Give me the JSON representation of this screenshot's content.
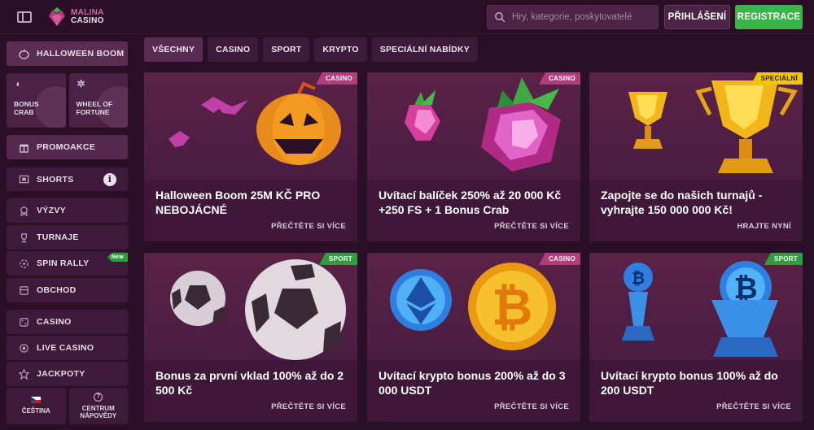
{
  "header": {
    "brand_line1": "MALINA",
    "brand_line2": "CASINO",
    "search_placeholder": "Hry, kategorie, poskytovatelé",
    "login_label": "PŘIHLÁŠENÍ",
    "register_label": "REGISTRACE"
  },
  "sidebar": {
    "halloween": "HALLOWEEN BOOM",
    "tiles": [
      {
        "label1": "BONUS",
        "label2": "CRAB"
      },
      {
        "label1": "WHEEL OF",
        "label2": "FORTUNE"
      }
    ],
    "items": [
      {
        "label": "PROMOAKCE",
        "icon": "gift-icon"
      },
      {
        "label": "SHORTS",
        "icon": "film-icon"
      },
      {
        "label": "VÝZVY",
        "icon": "medal-icon"
      },
      {
        "label": "TURNAJE",
        "icon": "trophy-icon"
      },
      {
        "label": "SPIN RALLY",
        "icon": "spin-icon",
        "badge": "New"
      },
      {
        "label": "OBCHOD",
        "icon": "shop-icon"
      },
      {
        "label": "CASINO",
        "icon": "dice-icon"
      },
      {
        "label": "LIVE CASINO",
        "icon": "live-icon"
      },
      {
        "label": "JACKPOTY",
        "icon": "jackpot-icon"
      }
    ],
    "language": "ČEŠTINA",
    "help_line1": "CENTRUM",
    "help_line2": "NÁPOVĚDY"
  },
  "filters": [
    "VŠECHNY",
    "CASINO",
    "SPORT",
    "KRYPTO",
    "SPECIÁLNÍ NABÍDKY"
  ],
  "cards": [
    {
      "tag": "CASINO",
      "title": "Halloween Boom 25M KČ PRO NEBOJÁCNÉ",
      "cta": "PŘEČTĚTE SI VÍCE"
    },
    {
      "tag": "CASINO",
      "title": "Uvítací balíček 250% až 20 000 Kč +250 FS + 1 Bonus Crab",
      "cta": "PŘEČTĚTE SI VÍCE"
    },
    {
      "tag": "SPECIÁLNÍ",
      "title": "Zapojte se do našich turnajů - vyhrajte 150 000 000 Kč!",
      "cta": "HRAJTE NYNÍ"
    },
    {
      "tag": "SPORT",
      "title": "Bonus za první vklad 100% až do 2 500 Kč",
      "cta": "PŘEČTĚTE SI VÍCE"
    },
    {
      "tag": "CASINO",
      "title": "Uvítací krypto bonus 200% až do 3 000 USDT",
      "cta": "PŘEČTĚTE SI VÍCE"
    },
    {
      "tag": "SPORT",
      "title": "Uvítací krypto bonus 100% až do 200 USDT",
      "cta": "PŘEČTĚTE SI VÍCE"
    }
  ],
  "colors": {
    "accent_green": "#39b54a",
    "tag_casino": "#b23c7d",
    "tag_sport": "#2aa040",
    "tag_special": "#f1c500"
  }
}
